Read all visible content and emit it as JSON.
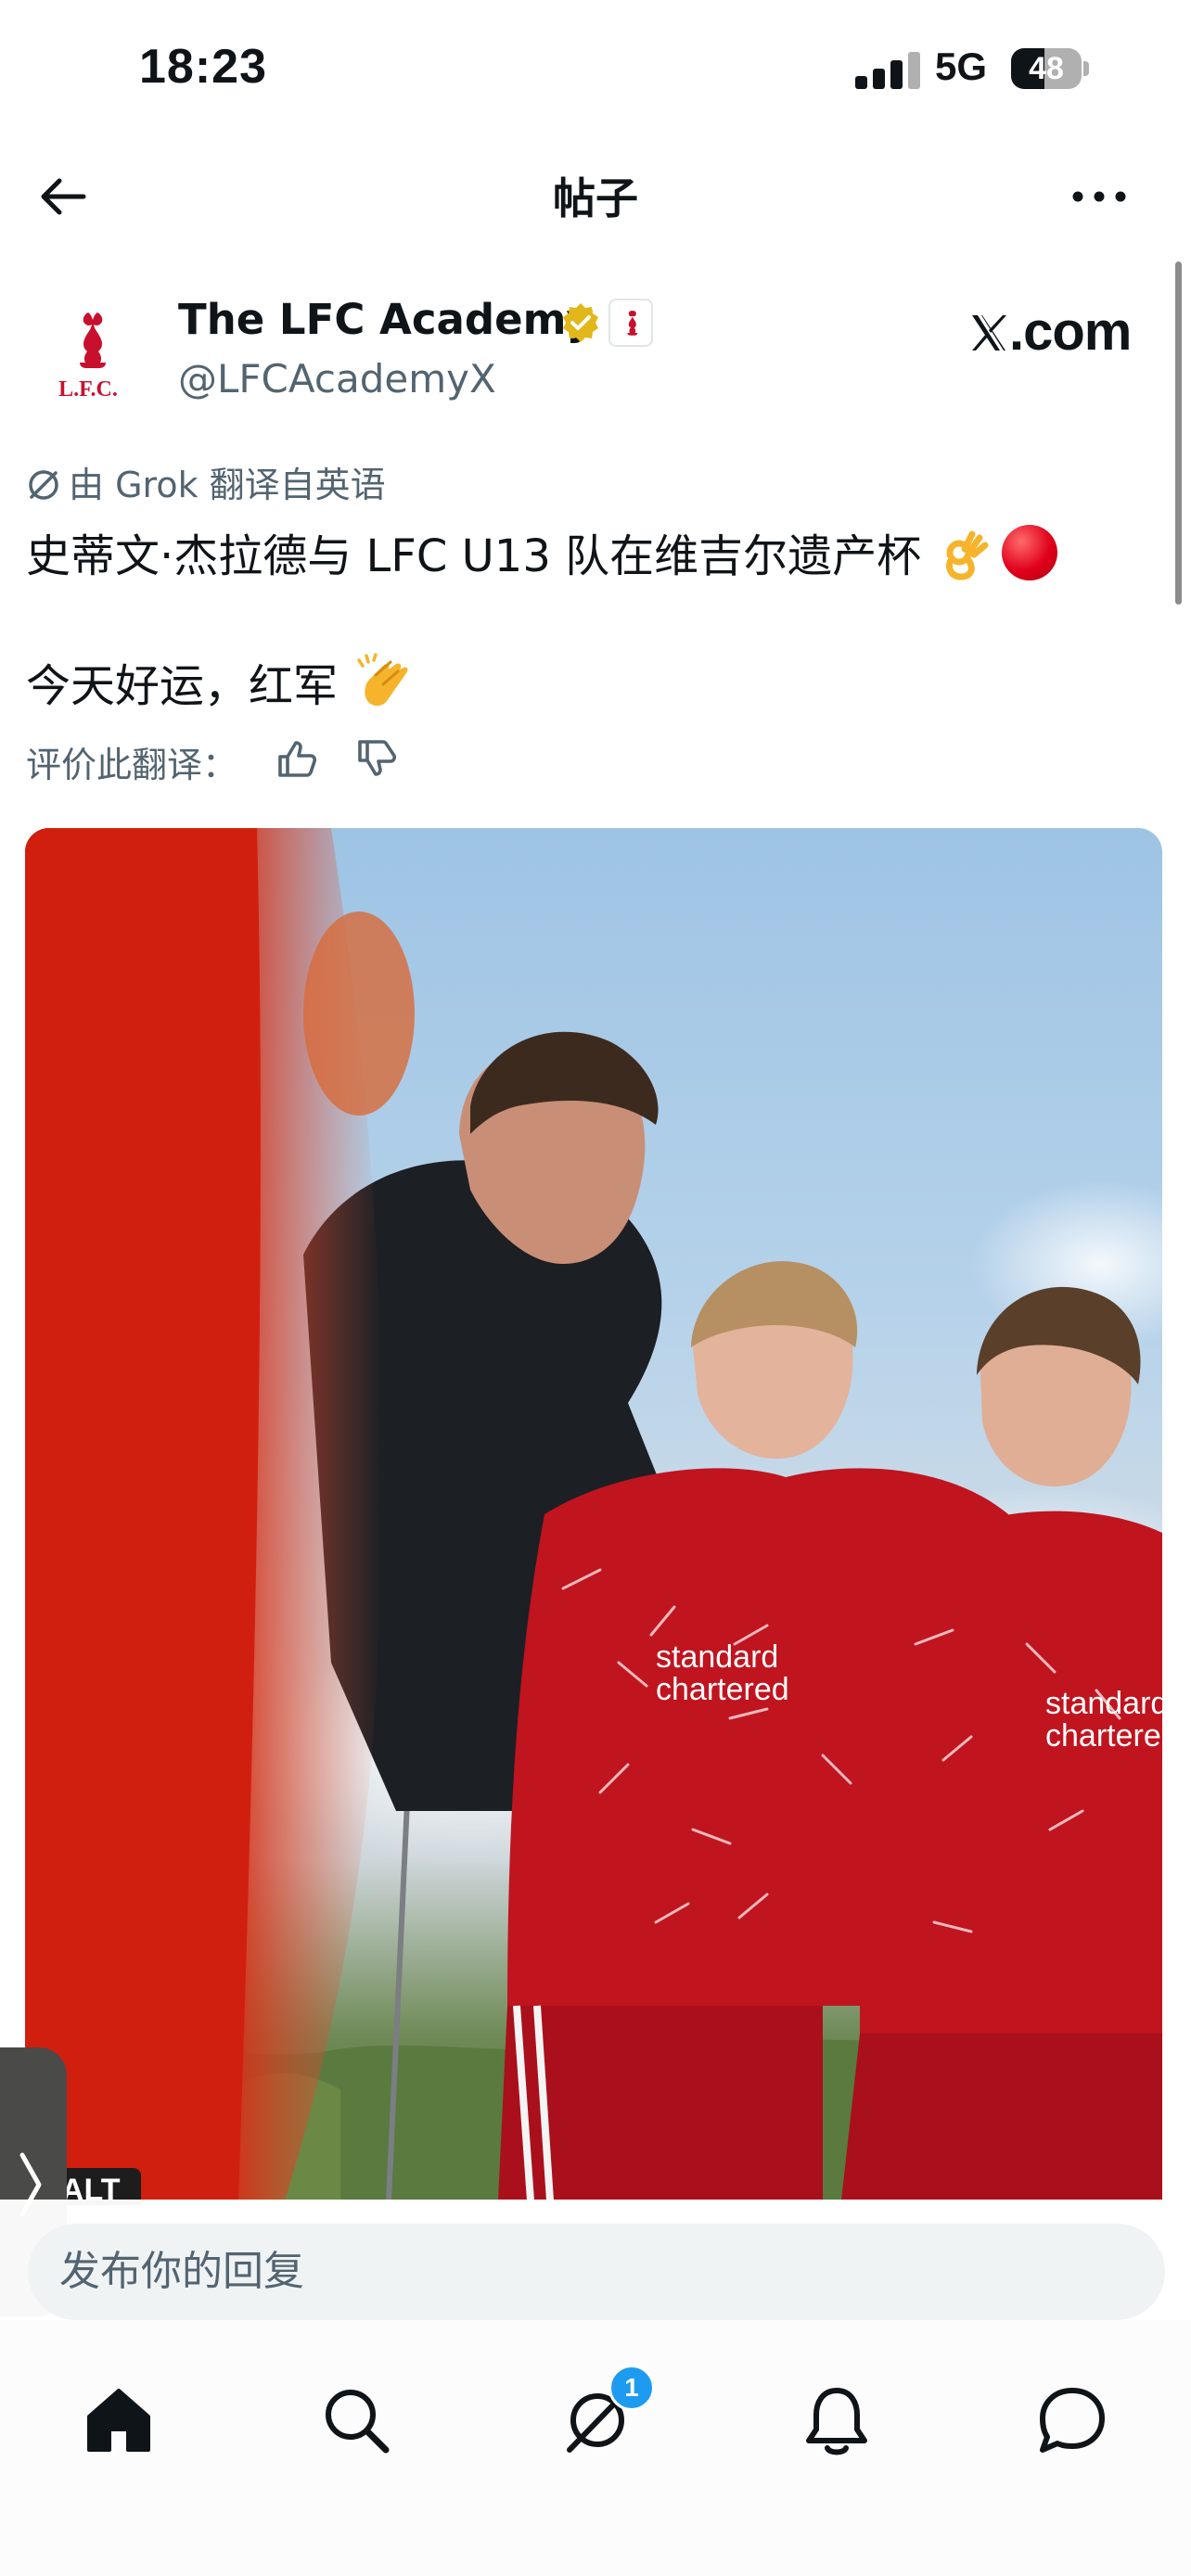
{
  "status_bar": {
    "time": "18:23",
    "network": "5G",
    "battery": "48",
    "battery_level": 0.48
  },
  "header": {
    "title": "帖子"
  },
  "author": {
    "name": "The LFC Academy",
    "handle": "@LFCAcademyX",
    "verified": true
  },
  "brand": "X.com",
  "translation": {
    "note": "由 Grok 翻译自英语",
    "rate_label": "评价此翻译："
  },
  "tweet": {
    "line1": "史蒂文·杰拉德与 LFC U13 队在维吉尔遗产杯",
    "line2": "今天好运，红军"
  },
  "media": {
    "alt_label": "ALT",
    "shirt_sponsor": "standard chartered"
  },
  "reply": {
    "placeholder": "发布你的回复"
  },
  "nav": {
    "items": [
      "home-icon",
      "search-icon",
      "grok-icon",
      "notifications-icon",
      "messages-icon"
    ],
    "badge": "1"
  },
  "colors": {
    "accent": "#1d9bf0",
    "lfc_red": "#c8102e",
    "verified_gold": "#e2b719"
  }
}
